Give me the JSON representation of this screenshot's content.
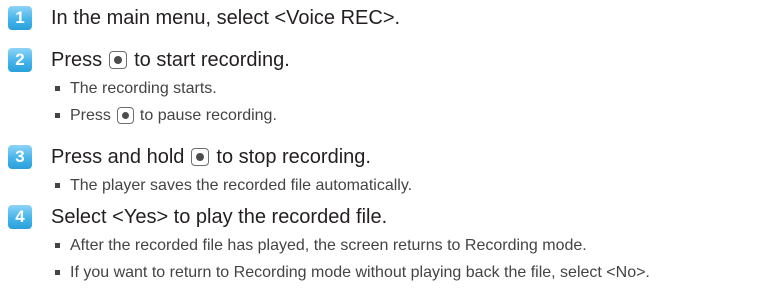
{
  "steps": [
    {
      "number": "1",
      "text": "In the main menu, select <Voice REC>.",
      "bullets": []
    },
    {
      "number": "2",
      "text_before": "Press",
      "text_after": "to start recording.",
      "bullets": [
        {
          "text": "The recording starts."
        },
        {
          "text_before": "Press",
          "text_after": "to pause recording."
        }
      ]
    },
    {
      "number": "3",
      "text_before": "Press and hold",
      "text_after": "to stop recording.",
      "bullets": [
        {
          "text": "The player saves the recorded file automatically."
        }
      ]
    },
    {
      "number": "4",
      "text": "Select <Yes> to play the recorded file.",
      "bullets": [
        {
          "text": "After the recorded file has played, the screen returns to Recording mode."
        },
        {
          "text": "If you want to return to Recording mode without playing back the file, select <No>."
        }
      ]
    }
  ],
  "icons": {
    "step_number_color": "#45b4ea",
    "record_button_icon": "record-button-icon"
  }
}
